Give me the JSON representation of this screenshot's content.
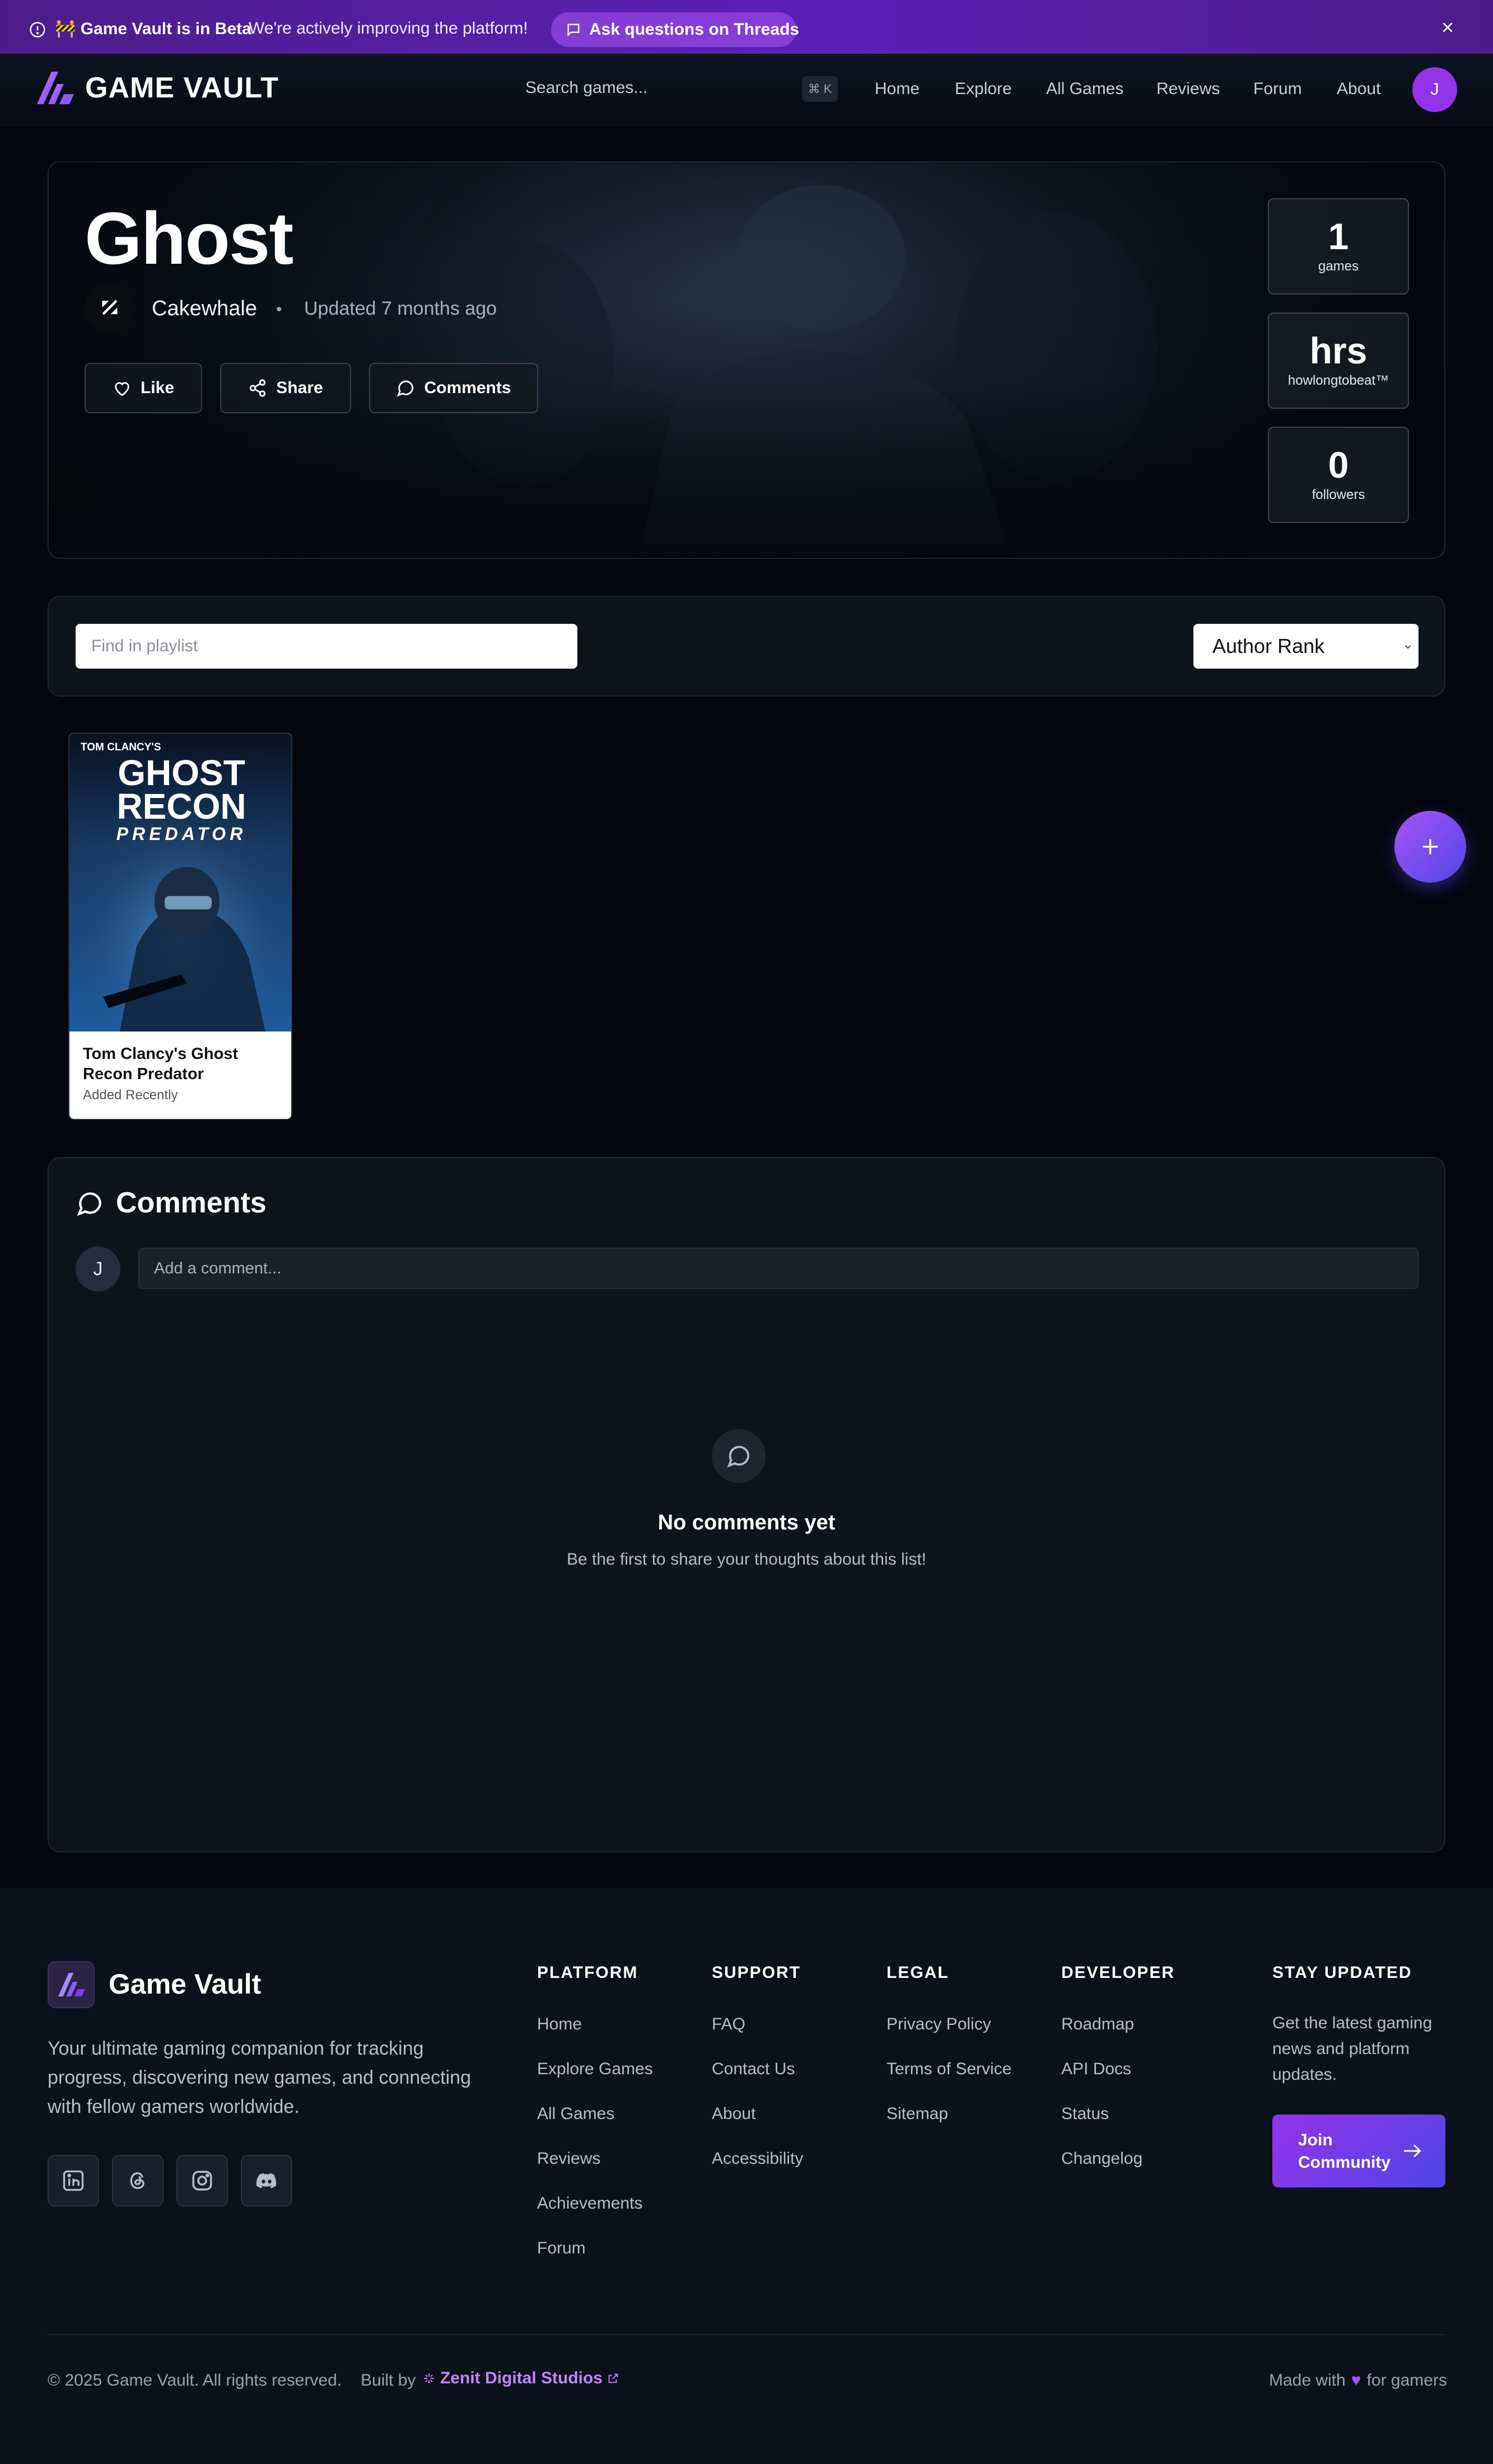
{
  "banner": {
    "title": "🚧 Game Vault is in Beta",
    "message": "We're actively improving the platform!",
    "threads_button": "Ask questions on Threads"
  },
  "nav": {
    "brand": "GAME VAULT",
    "search_placeholder": "Search games...",
    "shortcut": "⌘ K",
    "links": [
      "Home",
      "Explore",
      "All Games",
      "Reviews",
      "Forum",
      "About"
    ],
    "user_initial": "J"
  },
  "playlist": {
    "title": "Ghost",
    "author": "Cakewhale",
    "separator": "•",
    "updated": "Updated 7 months ago",
    "actions": {
      "like": "Like",
      "share": "Share",
      "comments": "Comments"
    },
    "stats": [
      {
        "value": "1",
        "label": "games"
      },
      {
        "value": "hrs",
        "label": "howlongtobeat™"
      },
      {
        "value": "0",
        "label": "followers"
      }
    ]
  },
  "filter": {
    "find_placeholder": "Find in playlist",
    "sort_selected": "Author Rank"
  },
  "games": [
    {
      "title": "Tom Clancy's Ghost Recon Predator",
      "added": "Added Recently",
      "cover": {
        "brand": "TOM CLANCY'S",
        "line1": "GHOST",
        "line2": "RECON",
        "line3": "PREDATOR"
      }
    }
  ],
  "comments": {
    "heading": "Comments",
    "user_initial": "J",
    "input_placeholder": "Add a comment...",
    "empty_title": "No comments yet",
    "empty_text": "Be the first to share your thoughts about this list!"
  },
  "footer": {
    "brand": "Game Vault",
    "description": "Your ultimate gaming companion for tracking progress, discovering new games, and connecting with fellow gamers worldwide.",
    "socials": [
      "linkedin-icon",
      "threads-icon",
      "instagram-icon",
      "discord-icon"
    ],
    "columns": [
      {
        "heading": "PLATFORM",
        "links": [
          "Home",
          "Explore Games",
          "All Games",
          "Reviews",
          "Achievements",
          "Forum"
        ]
      },
      {
        "heading": "SUPPORT",
        "links": [
          "FAQ",
          "Contact Us",
          "About",
          "Accessibility"
        ]
      },
      {
        "heading": "LEGAL",
        "links": [
          "Privacy Policy",
          "Terms of Service",
          "Sitemap"
        ]
      },
      {
        "heading": "DEVELOPER",
        "links": [
          "Roadmap",
          "API Docs",
          "Status",
          "Changelog"
        ]
      }
    ],
    "stay_updated": {
      "heading": "STAY UPDATED",
      "text": "Get the latest gaming news and platform updates.",
      "button": "Join Community"
    },
    "copyright": "© 2025 Game Vault. All rights reserved.",
    "built_by": "Built by",
    "studio": "Zenit Digital Studios",
    "made_with_prefix": "Made with",
    "heart": "♥",
    "made_with_suffix": "for gamers"
  },
  "colors": {
    "accent": "#9333ea",
    "accent_secondary": "#4f46e5",
    "background": "#04070f",
    "studio_link": "#c084fc"
  }
}
